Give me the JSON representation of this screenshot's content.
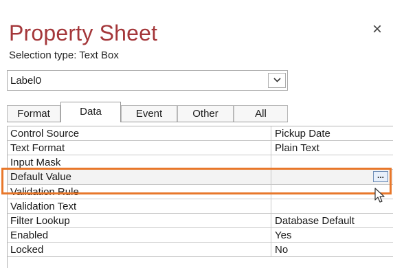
{
  "panel": {
    "title": "Property Sheet",
    "selection_type": "Selection type:  Text Box",
    "close_glyph": "×"
  },
  "object_selector": {
    "value": "Label0",
    "icon": "chevron-down-icon"
  },
  "tabs": [
    {
      "label": "Format",
      "active": false
    },
    {
      "label": "Data",
      "active": true
    },
    {
      "label": "Event",
      "active": false
    },
    {
      "label": "Other",
      "active": false
    },
    {
      "label": "All",
      "active": false
    }
  ],
  "properties": [
    {
      "name": "Control Source",
      "value": "Pickup Date"
    },
    {
      "name": "Text Format",
      "value": "Plain Text"
    },
    {
      "name": "Input Mask",
      "value": ""
    },
    {
      "name": "Default Value",
      "value": ""
    },
    {
      "name": "Validation Rule",
      "value": ""
    },
    {
      "name": "Validation Text",
      "value": ""
    },
    {
      "name": "Filter Lookup",
      "value": "Database Default"
    },
    {
      "name": "Enabled",
      "value": "Yes"
    },
    {
      "name": "Locked",
      "value": "No"
    }
  ],
  "builder_button": {
    "label": "...",
    "icon": "ellipsis-icon"
  },
  "colors": {
    "title": "#a4373a",
    "highlight": "#e8772a"
  }
}
